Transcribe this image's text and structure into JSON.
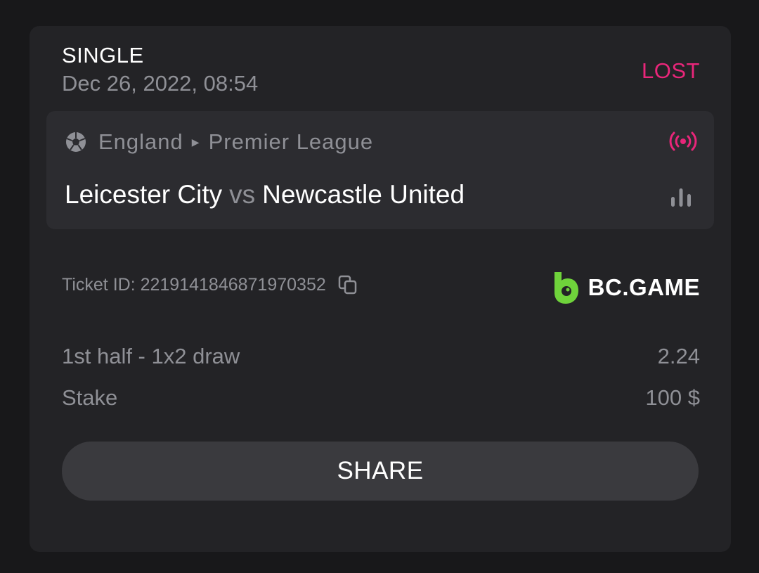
{
  "bet": {
    "type": "SINGLE",
    "date": "Dec 26, 2022, 08:54",
    "status": "LOST",
    "status_color": "#e9267a"
  },
  "match": {
    "sport_icon": "soccer-ball-icon",
    "country": "England",
    "league": "Premier League",
    "home_team": "Leicester City",
    "vs": "vs",
    "away_team": "Newcastle United",
    "live_icon": "live-broadcast-icon",
    "stats_icon": "stats-bars-icon"
  },
  "ticket": {
    "label": "Ticket ID: 2219141846871970352",
    "copy_icon": "copy-icon"
  },
  "brand": {
    "name": "BC.GAME",
    "accent": "#6fd33b"
  },
  "selection": {
    "market": "1st half - 1x2 draw",
    "odds": "2.24"
  },
  "stake": {
    "label": "Stake",
    "value": "100 $"
  },
  "actions": {
    "share_label": "SHARE"
  }
}
